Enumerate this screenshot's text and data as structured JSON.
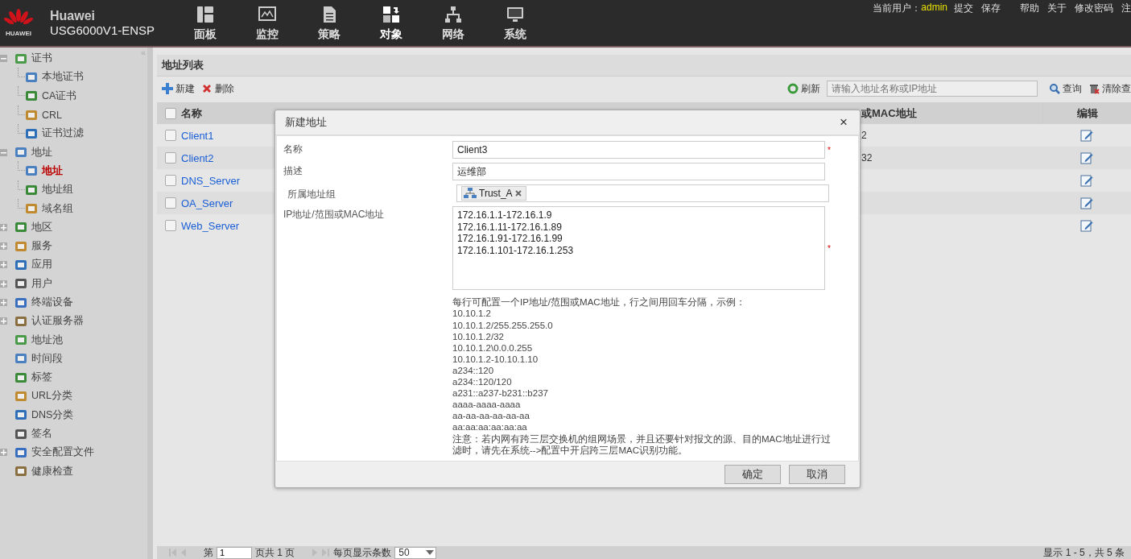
{
  "header": {
    "logo_text": "HUAWEI",
    "brand": "Huawei",
    "model": "USG6000V1-ENSP",
    "nav": [
      {
        "label": "面板",
        "selected": false
      },
      {
        "label": "监控",
        "selected": false
      },
      {
        "label": "策略",
        "selected": false
      },
      {
        "label": "对象",
        "selected": true
      },
      {
        "label": "网络",
        "selected": false
      },
      {
        "label": "系统",
        "selected": false
      }
    ],
    "user_label": "当前用户：",
    "user": "admin",
    "links": [
      "提交",
      "保存",
      "帮助",
      "关于",
      "修改密码",
      "注"
    ]
  },
  "sidebar": {
    "collapse": "«",
    "items": [
      {
        "label": "证书",
        "expanded": true,
        "selected": false,
        "children": [
          {
            "label": "本地证书",
            "selected": false
          },
          {
            "label": "CA证书",
            "selected": false
          },
          {
            "label": "CRL",
            "selected": false
          },
          {
            "label": "证书过滤",
            "selected": false
          }
        ]
      },
      {
        "label": "地址",
        "expanded": true,
        "selected": false,
        "children": [
          {
            "label": "地址",
            "selected": true
          },
          {
            "label": "地址组",
            "selected": false
          },
          {
            "label": "域名组",
            "selected": false
          }
        ]
      },
      {
        "label": "地区",
        "expanded": false,
        "selected": false
      },
      {
        "label": "服务",
        "expanded": false,
        "selected": false
      },
      {
        "label": "应用",
        "expanded": false,
        "selected": false
      },
      {
        "label": "用户",
        "expanded": false,
        "selected": false
      },
      {
        "label": "终端设备",
        "expanded": false,
        "selected": false
      },
      {
        "label": "认证服务器",
        "expanded": false,
        "selected": false
      },
      {
        "label": "地址池",
        "selected": false
      },
      {
        "label": "时间段",
        "selected": false
      },
      {
        "label": "标签",
        "selected": false
      },
      {
        "label": "URL分类",
        "selected": false
      },
      {
        "label": "DNS分类",
        "selected": false
      },
      {
        "label": "签名",
        "selected": false
      },
      {
        "label": "安全配置文件",
        "expanded": false,
        "selected": false
      },
      {
        "label": "健康检查",
        "selected": false
      }
    ]
  },
  "panel": {
    "title": "地址列表",
    "toolbar": {
      "new": "新建",
      "delete": "删除",
      "refresh": "刷新",
      "search": {
        "placeholder": "请输入地址名称或IP地址"
      },
      "query": "查询",
      "clear": "清除查"
    },
    "table": {
      "select_all_checked": false,
      "columns": [
        "名称",
        "或MAC地址",
        "编辑"
      ],
      "rows": [
        {
          "name": "Client1",
          "address": "2",
          "checked": false
        },
        {
          "name": "Client2",
          "address": "32",
          "checked": false
        },
        {
          "name": "DNS_Server",
          "checked": false
        },
        {
          "name": "OA_Server",
          "checked": false
        },
        {
          "name": "Web_Server",
          "checked": false
        }
      ]
    },
    "pagination": {
      "page_prefix": "第",
      "page": "1",
      "page_suffix": "页共 1 页",
      "per_page_label": "每页显示条数",
      "per_page": "50",
      "summary": "显示 1 - 5，共 5 条"
    }
  },
  "dialog": {
    "title": "新建地址",
    "close": "×",
    "required_mark": "*",
    "fields": [
      {
        "kind": "text",
        "label": "名称",
        "value": "Client3",
        "required": true
      },
      {
        "kind": "text",
        "label": "描述",
        "value": "运维部",
        "required": false
      },
      {
        "kind": "tags",
        "label": "所属地址组",
        "tags": [
          "Trust_A"
        ],
        "required": false
      },
      {
        "kind": "textarea",
        "label": "IP地址/范围或MAC地址",
        "lines": [
          "172.16.1.1-172.16.1.9",
          "172.16.1.11-172.16.1.89",
          "172.16.1.91-172.16.1.99",
          "172.16.1.101-172.16.1.253"
        ],
        "required": true
      }
    ],
    "hint": "每行可配置一个IP地址/范围或MAC地址，行之间用回车分隔，示例：",
    "examples": [
      "10.10.1.2",
      "10.10.1.2/255.255.255.0",
      "10.10.1.2/32",
      "10.10.1.2\\0.0.0.255",
      "10.10.1.2-10.10.1.10",
      "a234::120",
      "a234::120/120",
      "a231::a237-b231::b237",
      "aaaa-aaaa-aaaa",
      "aa-aa-aa-aa-aa-aa",
      "aa:aa:aa:aa:aa:aa"
    ],
    "note": "注意：若内网有跨三层交换机的组网场景，并且还要针对报文的源、目的MAC地址进行过滤时，请先在系统-->配置中开启跨三层MAC识别功能。",
    "buttons": [
      "确定",
      "取消"
    ]
  }
}
